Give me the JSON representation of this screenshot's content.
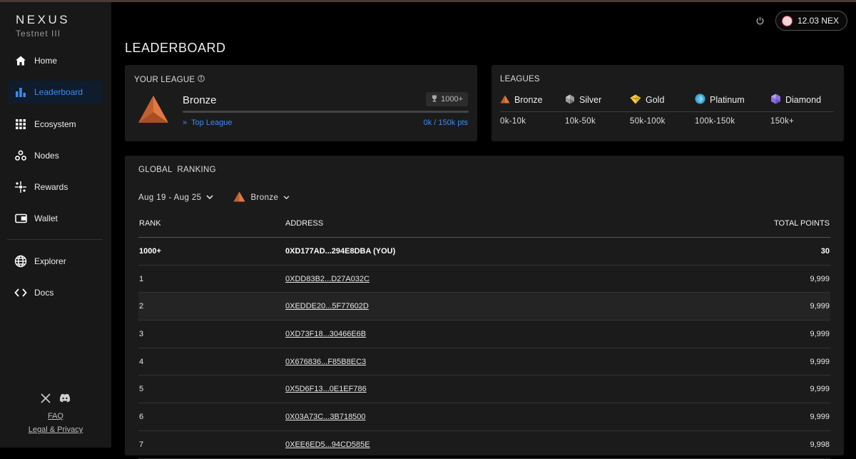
{
  "brand": {
    "name": "NEXUS",
    "subtitle": "Testnet III"
  },
  "sidebar": {
    "items": [
      {
        "label": "Home",
        "icon": "home-icon"
      },
      {
        "label": "Leaderboard",
        "icon": "bar-chart-icon",
        "active": true
      },
      {
        "label": "Ecosystem",
        "icon": "grid-icon"
      },
      {
        "label": "Nodes",
        "icon": "nodes-icon"
      },
      {
        "label": "Rewards",
        "icon": "sparkle-icon"
      },
      {
        "label": "Wallet",
        "icon": "wallet-icon"
      },
      {
        "label": "Explorer",
        "icon": "globe-icon"
      },
      {
        "label": "Docs",
        "icon": "code-icon"
      }
    ],
    "footer": {
      "faq": "FAQ",
      "legal": "Legal & Privacy"
    }
  },
  "header": {
    "balance": "12.03 NEX"
  },
  "page_title": "LEADERBOARD",
  "your_league": {
    "label": "YOUR LEAGUE",
    "name": "Bronze",
    "rank": "1000+",
    "progress": 0.0,
    "top_league_link": "Top League",
    "points": "0k / 150k pts"
  },
  "leagues": {
    "label": "LEAGUES",
    "items": [
      {
        "name": "Bronze",
        "range": "0k-10k",
        "color": "#d9743f"
      },
      {
        "name": "Silver",
        "range": "10k-50k",
        "color": "#9c9c9c"
      },
      {
        "name": "Gold",
        "range": "50k-100k",
        "color": "#e6b52a"
      },
      {
        "name": "Platinum",
        "range": "100k-150k",
        "color": "#3fa7d6"
      },
      {
        "name": "Diamond",
        "range": "150k+",
        "color": "#8c6fe0"
      }
    ]
  },
  "ranking": {
    "label": "GLOBAL  RANKING",
    "date_filter": "Aug 19 - Aug 25",
    "league_filter": "Bronze",
    "columns": {
      "rank": "RANK",
      "address": "ADDRESS",
      "points": "TOTAL POINTS"
    },
    "you": {
      "rank": "1000+",
      "address": "0XD177AD...294E8DBA (YOU)",
      "points": "30"
    },
    "rows": [
      {
        "rank": "1",
        "address": "0XDD83B2...D27A032C",
        "points": "9,999"
      },
      {
        "rank": "2",
        "address": "0XEDDE20...5F77602D",
        "points": "9,999"
      },
      {
        "rank": "3",
        "address": "0XD73F18...30466E6B",
        "points": "9,999"
      },
      {
        "rank": "4",
        "address": "0X676836...F85B8EC3",
        "points": "9,999"
      },
      {
        "rank": "5",
        "address": "0X5D6F13...0E1EF786",
        "points": "9,999"
      },
      {
        "rank": "6",
        "address": "0X03A73C...3B718500",
        "points": "9,999"
      },
      {
        "rank": "7",
        "address": "0XEE6ED5...94CD585E",
        "points": "9,998"
      }
    ]
  }
}
